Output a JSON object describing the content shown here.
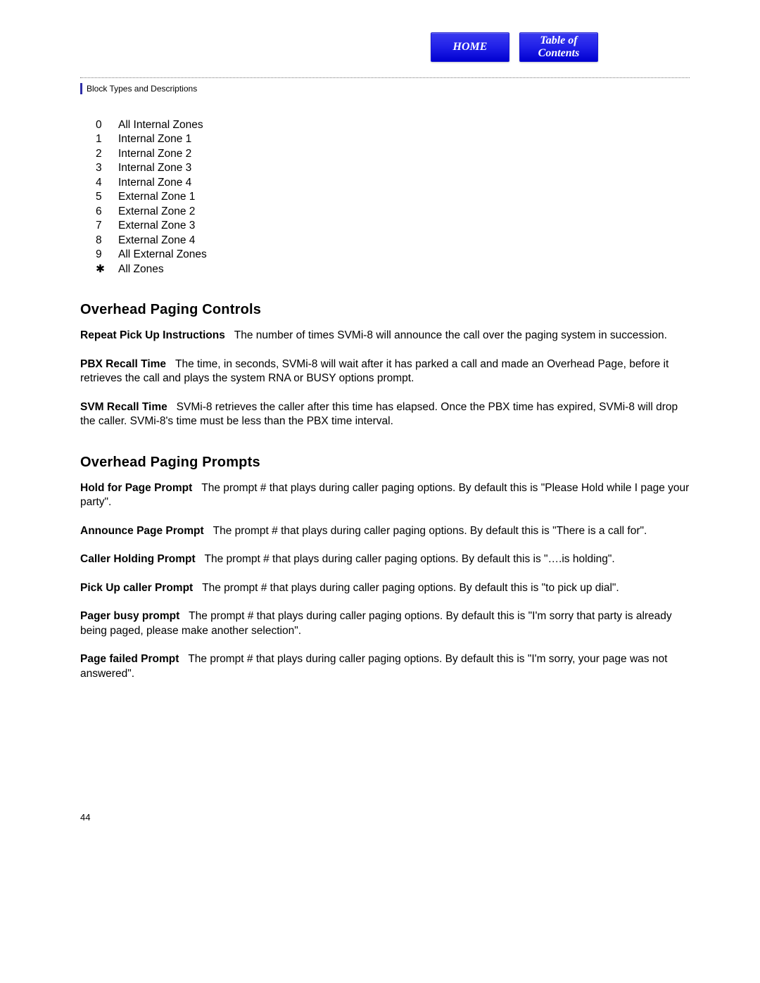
{
  "nav": {
    "home": "HOME",
    "toc_line1": "Table of",
    "toc_line2": "Contents"
  },
  "breadcrumb": "Block Types and Descriptions",
  "zone_list": [
    {
      "key": "0",
      "label": "All Internal Zones"
    },
    {
      "key": "1",
      "label": "Internal Zone 1"
    },
    {
      "key": "2",
      "label": "Internal Zone 2"
    },
    {
      "key": "3",
      "label": "Internal Zone 3"
    },
    {
      "key": "4",
      "label": "Internal Zone 4"
    },
    {
      "key": "5",
      "label": "External Zone 1"
    },
    {
      "key": "6",
      "label": "External Zone 2"
    },
    {
      "key": "7",
      "label": "External Zone 3"
    },
    {
      "key": "8",
      "label": "External Zone 4"
    },
    {
      "key": "9",
      "label": "All External Zones"
    },
    {
      "key": "✱",
      "label": "All Zones"
    }
  ],
  "sections": {
    "controls": {
      "heading": "Overhead Paging Controls",
      "items": [
        {
          "term": "Repeat Pick Up Instructions",
          "body": "The number of times SVMi-8 will announce the call over the paging system in succession."
        },
        {
          "term": "PBX Recall Time",
          "body": "The time, in seconds, SVMi-8 will wait after it has parked a call and made an Overhead Page, before it retrieves the call and plays the system RNA or BUSY options prompt."
        },
        {
          "term": "SVM Recall Time",
          "body": "SVMi-8 retrieves the caller after this time has elapsed.  Once the PBX time has expired, SVMi-8 will drop the caller. SVMi-8's time must be less than the PBX time interval."
        }
      ]
    },
    "prompts": {
      "heading": "Overhead Paging Prompts",
      "items": [
        {
          "term": "Hold for Page Prompt",
          "body": "The prompt # that plays during caller paging options. By default this is \"Please Hold while I page your party\"."
        },
        {
          "term": "Announce Page Prompt",
          "body": "The prompt # that plays during caller paging options. By default this is \"There is a call for\"."
        },
        {
          "term": "Caller Holding Prompt",
          "body": "The prompt # that plays during caller paging options. By default this is \"….is holding\"."
        },
        {
          "term": "Pick Up caller Prompt",
          "body": "The prompt # that plays during caller paging options. By default this is \"to pick up dial\"."
        },
        {
          "term": "Pager busy prompt",
          "body": "The prompt # that plays during caller paging options. By default this is \"I'm sorry that party is already being paged, please make another selection\"."
        },
        {
          "term": "Page failed Prompt",
          "body": "The prompt # that plays during caller paging options. By default this is \"I'm sorry, your page was not answered\"."
        }
      ]
    }
  },
  "page_number": "44"
}
